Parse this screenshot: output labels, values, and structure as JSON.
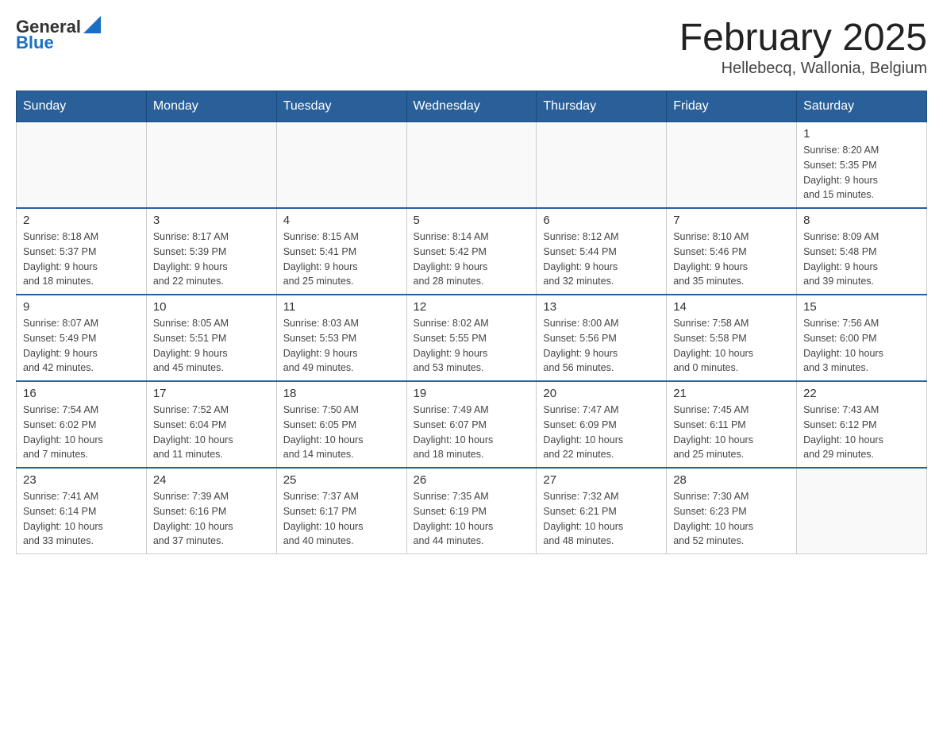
{
  "logo": {
    "text_general": "General",
    "text_blue": "Blue"
  },
  "title": "February 2025",
  "location": "Hellebecq, Wallonia, Belgium",
  "weekdays": [
    "Sunday",
    "Monday",
    "Tuesday",
    "Wednesday",
    "Thursday",
    "Friday",
    "Saturday"
  ],
  "weeks": [
    [
      {
        "day": "",
        "info": ""
      },
      {
        "day": "",
        "info": ""
      },
      {
        "day": "",
        "info": ""
      },
      {
        "day": "",
        "info": ""
      },
      {
        "day": "",
        "info": ""
      },
      {
        "day": "",
        "info": ""
      },
      {
        "day": "1",
        "info": "Sunrise: 8:20 AM\nSunset: 5:35 PM\nDaylight: 9 hours\nand 15 minutes."
      }
    ],
    [
      {
        "day": "2",
        "info": "Sunrise: 8:18 AM\nSunset: 5:37 PM\nDaylight: 9 hours\nand 18 minutes."
      },
      {
        "day": "3",
        "info": "Sunrise: 8:17 AM\nSunset: 5:39 PM\nDaylight: 9 hours\nand 22 minutes."
      },
      {
        "day": "4",
        "info": "Sunrise: 8:15 AM\nSunset: 5:41 PM\nDaylight: 9 hours\nand 25 minutes."
      },
      {
        "day": "5",
        "info": "Sunrise: 8:14 AM\nSunset: 5:42 PM\nDaylight: 9 hours\nand 28 minutes."
      },
      {
        "day": "6",
        "info": "Sunrise: 8:12 AM\nSunset: 5:44 PM\nDaylight: 9 hours\nand 32 minutes."
      },
      {
        "day": "7",
        "info": "Sunrise: 8:10 AM\nSunset: 5:46 PM\nDaylight: 9 hours\nand 35 minutes."
      },
      {
        "day": "8",
        "info": "Sunrise: 8:09 AM\nSunset: 5:48 PM\nDaylight: 9 hours\nand 39 minutes."
      }
    ],
    [
      {
        "day": "9",
        "info": "Sunrise: 8:07 AM\nSunset: 5:49 PM\nDaylight: 9 hours\nand 42 minutes."
      },
      {
        "day": "10",
        "info": "Sunrise: 8:05 AM\nSunset: 5:51 PM\nDaylight: 9 hours\nand 45 minutes."
      },
      {
        "day": "11",
        "info": "Sunrise: 8:03 AM\nSunset: 5:53 PM\nDaylight: 9 hours\nand 49 minutes."
      },
      {
        "day": "12",
        "info": "Sunrise: 8:02 AM\nSunset: 5:55 PM\nDaylight: 9 hours\nand 53 minutes."
      },
      {
        "day": "13",
        "info": "Sunrise: 8:00 AM\nSunset: 5:56 PM\nDaylight: 9 hours\nand 56 minutes."
      },
      {
        "day": "14",
        "info": "Sunrise: 7:58 AM\nSunset: 5:58 PM\nDaylight: 10 hours\nand 0 minutes."
      },
      {
        "day": "15",
        "info": "Sunrise: 7:56 AM\nSunset: 6:00 PM\nDaylight: 10 hours\nand 3 minutes."
      }
    ],
    [
      {
        "day": "16",
        "info": "Sunrise: 7:54 AM\nSunset: 6:02 PM\nDaylight: 10 hours\nand 7 minutes."
      },
      {
        "day": "17",
        "info": "Sunrise: 7:52 AM\nSunset: 6:04 PM\nDaylight: 10 hours\nand 11 minutes."
      },
      {
        "day": "18",
        "info": "Sunrise: 7:50 AM\nSunset: 6:05 PM\nDaylight: 10 hours\nand 14 minutes."
      },
      {
        "day": "19",
        "info": "Sunrise: 7:49 AM\nSunset: 6:07 PM\nDaylight: 10 hours\nand 18 minutes."
      },
      {
        "day": "20",
        "info": "Sunrise: 7:47 AM\nSunset: 6:09 PM\nDaylight: 10 hours\nand 22 minutes."
      },
      {
        "day": "21",
        "info": "Sunrise: 7:45 AM\nSunset: 6:11 PM\nDaylight: 10 hours\nand 25 minutes."
      },
      {
        "day": "22",
        "info": "Sunrise: 7:43 AM\nSunset: 6:12 PM\nDaylight: 10 hours\nand 29 minutes."
      }
    ],
    [
      {
        "day": "23",
        "info": "Sunrise: 7:41 AM\nSunset: 6:14 PM\nDaylight: 10 hours\nand 33 minutes."
      },
      {
        "day": "24",
        "info": "Sunrise: 7:39 AM\nSunset: 6:16 PM\nDaylight: 10 hours\nand 37 minutes."
      },
      {
        "day": "25",
        "info": "Sunrise: 7:37 AM\nSunset: 6:17 PM\nDaylight: 10 hours\nand 40 minutes."
      },
      {
        "day": "26",
        "info": "Sunrise: 7:35 AM\nSunset: 6:19 PM\nDaylight: 10 hours\nand 44 minutes."
      },
      {
        "day": "27",
        "info": "Sunrise: 7:32 AM\nSunset: 6:21 PM\nDaylight: 10 hours\nand 48 minutes."
      },
      {
        "day": "28",
        "info": "Sunrise: 7:30 AM\nSunset: 6:23 PM\nDaylight: 10 hours\nand 52 minutes."
      },
      {
        "day": "",
        "info": ""
      }
    ]
  ]
}
